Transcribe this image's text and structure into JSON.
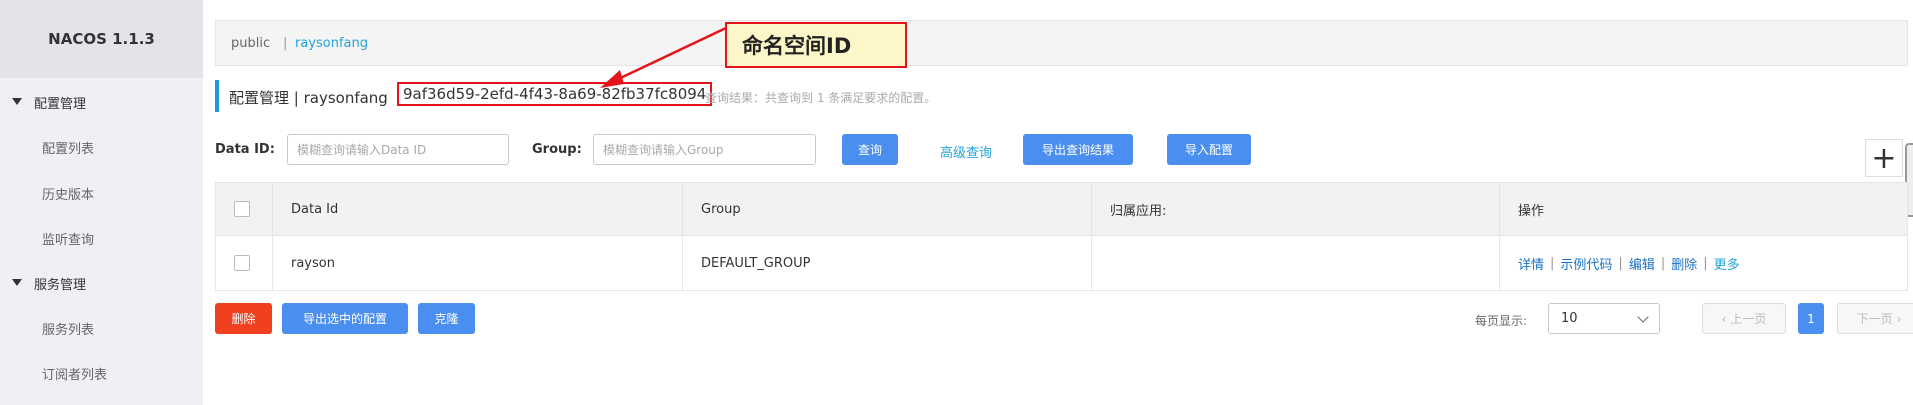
{
  "sidebar": {
    "logo": "NACOS 1.1.3",
    "groups": [
      {
        "label": "配置管理",
        "items": [
          {
            "label": "配置列表"
          },
          {
            "label": "历史版本"
          },
          {
            "label": "监听查询"
          }
        ]
      },
      {
        "label": "服务管理",
        "items": [
          {
            "label": "服务列表"
          },
          {
            "label": "订阅者列表"
          }
        ]
      }
    ]
  },
  "namespace_bar": {
    "public": "public",
    "separator": "|",
    "active": "raysonfang"
  },
  "title": {
    "text": "配置管理 | raysonfang",
    "namespace_id": "9af36d59-2efd-4f43-8a69-82fb37fc8094",
    "result": "查询结果：共查询到 1 条满足要求的配置。"
  },
  "annotation": {
    "callout": "命名空间ID",
    "colors": {
      "border": "#e4141a",
      "background": "#fdf6c8"
    }
  },
  "filters": {
    "data_id_label": "Data ID:",
    "data_id_placeholder": "模糊查询请输入Data ID",
    "data_id_value": "",
    "group_label": "Group:",
    "group_placeholder": "模糊查询请输入Group",
    "group_value": "",
    "search_button": "查询",
    "advanced_link": "高级查询",
    "export_results_button": "导出查询结果",
    "import_button": "导入配置",
    "add_icon": "plus-icon"
  },
  "table": {
    "headers": [
      "Data Id",
      "Group",
      "归属应用:",
      "操作"
    ],
    "rows": [
      {
        "data_id": "rayson",
        "group": "DEFAULT_GROUP",
        "app": "",
        "actions": [
          "详情",
          "示例代码",
          "编辑",
          "删除",
          "更多"
        ]
      }
    ]
  },
  "footer": {
    "delete_button": "删除",
    "export_selected_button": "导出选中的配置",
    "clone_button": "克隆",
    "page_size_label": "每页显示:",
    "page_size_value": "10",
    "prev_button": "上一页",
    "current_page": "1",
    "next_button": "下一页"
  },
  "colors": {
    "primary": "#4a8ff0",
    "danger": "#f0401f",
    "link": "#22a3d9",
    "sidebar_bg": "#eef0f5"
  }
}
